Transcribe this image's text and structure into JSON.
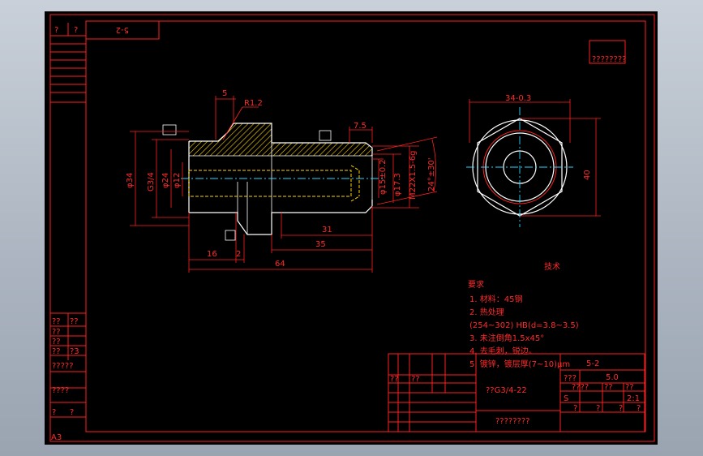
{
  "sheet": {
    "corner_code": "5-2",
    "top_left_marks": [
      "?",
      "?"
    ],
    "size_mark": "A3",
    "red_box_text": "????????"
  },
  "colors": {
    "background": "#000000",
    "outline": "#ffffff",
    "dimension": "#ff2020",
    "centerline": "#2bd6ff",
    "hidden_line": "#ffd400",
    "hatch": "#ffd400"
  },
  "front_view": {
    "dims": {
      "d34": "φ34",
      "g34": "G3/4",
      "d24": "φ24",
      "d12": "φ12",
      "d15": "φ15±0.2",
      "d17": "φ17.3",
      "m22": "M22X1.5-6g",
      "ang": "24°±30'",
      "r12": "R1.2",
      "top5": "5",
      "len75": "7.5",
      "len31": "31",
      "len35": "35",
      "len16": "16",
      "len2": "2",
      "len64": "64"
    }
  },
  "side_view": {
    "dims": {
      "width": "34-0.3",
      "height": "40"
    }
  },
  "notes": {
    "title1": "技术",
    "title2": "要求",
    "lines": [
      "1. 材料：45钢",
      "2. 热处理",
      "(254~302) HB(d=3.8~3.5)",
      "3. 未注倒角1.5x45°",
      "4. 去毛刺，锐边。",
      "5. 镀锌，镀层厚(7~10)μm"
    ]
  },
  "title_block": {
    "part_name": "??G3/4-22",
    "code": "5-2",
    "scale": "5.0",
    "ratio": "2:1",
    "sheet_mark": "S",
    "company": "????????",
    "small": [
      "?",
      "?",
      "?",
      "?",
      "???",
      "????",
      "??",
      "??",
      "??",
      "??"
    ]
  },
  "left_strip": {
    "lower_labels": [
      "??",
      "??",
      "??",
      "??",
      "??",
      "?3",
      "?????",
      "????",
      "?",
      "?"
    ]
  }
}
